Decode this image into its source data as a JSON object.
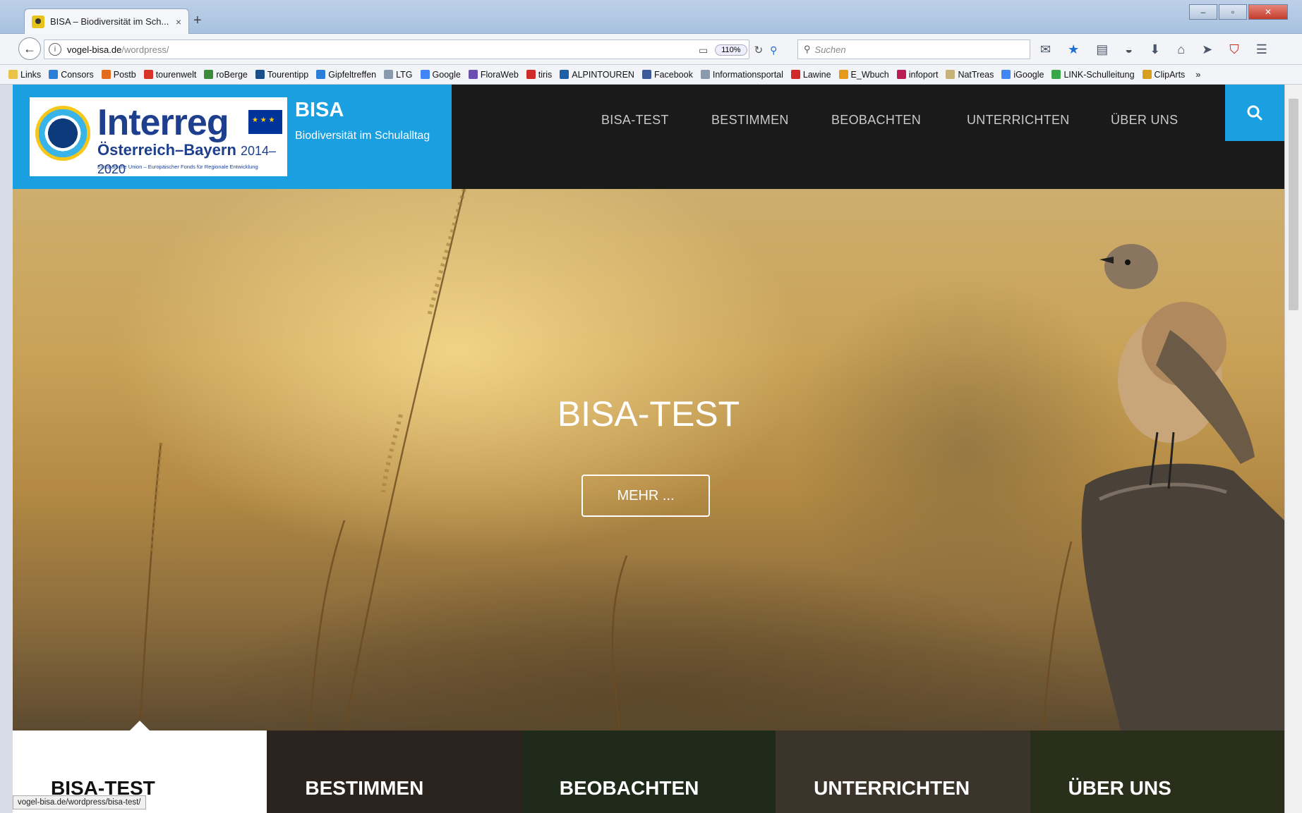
{
  "browser": {
    "tab_title": "BISA – Biodiversität im Sch...",
    "tab_close": "×",
    "new_tab": "+",
    "url_host": "vogel-bisa.de",
    "url_path": "/wordpress/",
    "zoom": "110%",
    "search_placeholder": "Suchen",
    "status_url": "vogel-bisa.de/wordpress/bisa-test/",
    "bookmarks": [
      {
        "label": "Links",
        "color": "#e9c24a"
      },
      {
        "label": "Consors",
        "color": "#2a7fd6"
      },
      {
        "label": "Postb",
        "color": "#e36b1c"
      },
      {
        "label": "tourenwelt",
        "color": "#d8342a"
      },
      {
        "label": "roBerge",
        "color": "#3c8b3a"
      },
      {
        "label": "Tourentipp",
        "color": "#1b4f8a"
      },
      {
        "label": "Gipfeltreffen",
        "color": "#2a7fd6"
      },
      {
        "label": "LTG",
        "color": "#8a9aad"
      },
      {
        "label": "Google",
        "color": "#4285f4"
      },
      {
        "label": "FloraWeb",
        "color": "#6a4fb0"
      },
      {
        "label": "tiris",
        "color": "#d12a2a"
      },
      {
        "label": "ALPINTOUREN",
        "color": "#1c5fa8"
      },
      {
        "label": "Facebook",
        "color": "#3b5998"
      },
      {
        "label": "Informationsportal",
        "color": "#8a9aad"
      },
      {
        "label": "Lawine",
        "color": "#d12a2a"
      },
      {
        "label": "E_Wbuch",
        "color": "#e69a1c"
      },
      {
        "label": "infoport",
        "color": "#b81e52"
      },
      {
        "label": "NatTreas",
        "color": "#c7b27a"
      },
      {
        "label": "iGoogle",
        "color": "#4285f4"
      },
      {
        "label": "LINK-Schulleitung",
        "color": "#3aa64a"
      },
      {
        "label": "ClipArts",
        "color": "#d6a01c"
      }
    ],
    "bookmarks_more": "»"
  },
  "site": {
    "logo_main": "Interreg",
    "logo_region": "Österreich–Bayern",
    "logo_years": "2014–2020",
    "logo_eu": "Europäische Union – Europäischer Fonds für Regionale Entwicklung",
    "title": "BISA",
    "tagline": "Biodiversität im Schulalltag",
    "menu": [
      "BISA-TEST",
      "BESTIMMEN",
      "BEOBACHTEN",
      "UNTERRICHTEN",
      "ÜBER UNS"
    ],
    "brand_color": "#1a9fe0"
  },
  "hero": {
    "title": "BISA-TEST",
    "button": "MEHR ..."
  },
  "features": [
    {
      "label": "BISA-TEST",
      "bg": "#ffffff"
    },
    {
      "label": "BESTIMMEN",
      "bg": "#2b241e"
    },
    {
      "label": "BEOBACHTEN",
      "bg": "#1f2a1a"
    },
    {
      "label": "UNTERRICHTEN",
      "bg": "#3a342a"
    },
    {
      "label": "ÜBER UNS",
      "bg": "#2a2f1c"
    }
  ]
}
